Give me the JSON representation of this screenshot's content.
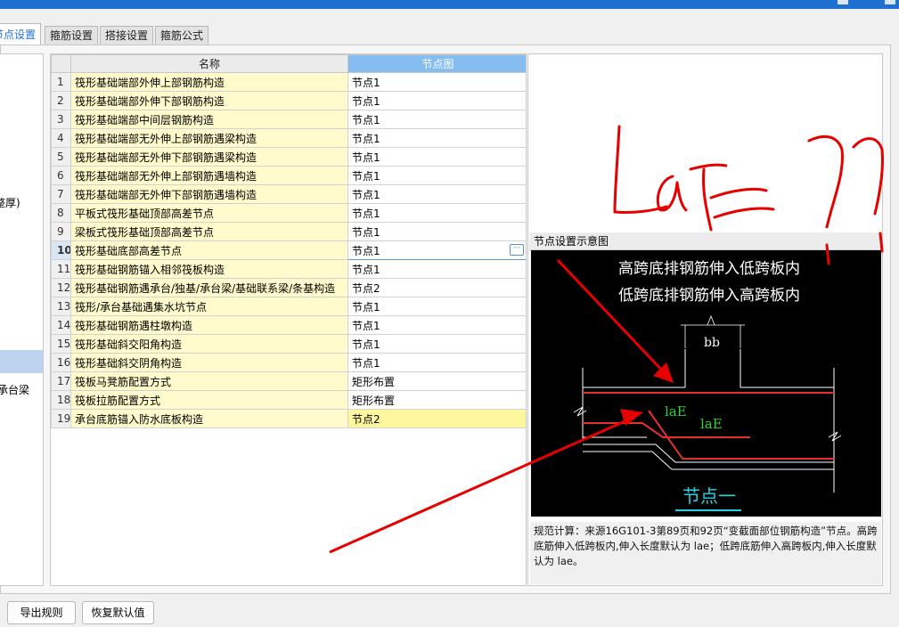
{
  "tabs": [
    {
      "label": "节点设置"
    },
    {
      "label": "箍筋设置"
    },
    {
      "label": "搭接设置"
    },
    {
      "label": "箍筋公式"
    }
  ],
  "left_list": {
    "items": [
      {
        "label": "整厚)"
      },
      {
        "label": ""
      },
      {
        "label": "承台梁"
      }
    ]
  },
  "grid": {
    "columns": [
      {
        "label": ""
      },
      {
        "label": "名称"
      },
      {
        "label": "节点图"
      }
    ],
    "rows": [
      {
        "num": "1",
        "name": "筏形基础端部外伸上部钢筋构造",
        "value": "节点1"
      },
      {
        "num": "2",
        "name": "筏形基础端部外伸下部钢筋构造",
        "value": "节点1"
      },
      {
        "num": "3",
        "name": "筏形基础端部中间层钢筋构造",
        "value": "节点1"
      },
      {
        "num": "4",
        "name": "筏形基础端部无外伸上部钢筋遇梁构造",
        "value": "节点1"
      },
      {
        "num": "5",
        "name": "筏形基础端部无外伸下部钢筋遇梁构造",
        "value": "节点1"
      },
      {
        "num": "6",
        "name": "筏形基础端部无外伸上部钢筋遇墙构造",
        "value": "节点1"
      },
      {
        "num": "7",
        "name": "筏形基础端部无外伸下部钢筋遇墙构造",
        "value": "节点1"
      },
      {
        "num": "8",
        "name": "平板式筏形基础顶部高差节点",
        "value": "节点1"
      },
      {
        "num": "9",
        "name": "梁板式筏形基础顶部高差节点",
        "value": "节点1"
      },
      {
        "num": "10",
        "name": "筏形基础底部高差节点",
        "value": "节点1"
      },
      {
        "num": "11",
        "name": "筏形基础钢筋锚入相邻筏板构造",
        "value": "节点1"
      },
      {
        "num": "12",
        "name": "筏形基础钢筋遇承台/独基/承台梁/基础联系梁/条基构造",
        "value": "节点2"
      },
      {
        "num": "13",
        "name": "筏形/承台基础遇集水坑节点",
        "value": "节点1"
      },
      {
        "num": "14",
        "name": "筏形基础钢筋遇柱墩构造",
        "value": "节点1"
      },
      {
        "num": "15",
        "name": "筏形基础斜交阳角构造",
        "value": "节点1"
      },
      {
        "num": "16",
        "name": "筏形基础斜交阴角构造",
        "value": "节点1"
      },
      {
        "num": "17",
        "name": "筏板马凳筋配置方式",
        "value": "矩形布置"
      },
      {
        "num": "18",
        "name": "筏板拉筋配置方式",
        "value": "矩形布置"
      },
      {
        "num": "19",
        "name": "承台底筋锚入防水底板构造",
        "value": "节点2"
      }
    ],
    "selected_row": "10",
    "more_button": "···"
  },
  "preview": {
    "title": "节点设置示意图",
    "line1": "高跨底排钢筋伸入低跨板内",
    "line2": "低跨底排钢筋伸入高跨板内",
    "label_bb": "bb",
    "label_lae1": "laE",
    "label_lae2": "laE",
    "caption": "节点一",
    "description": "规范计算：来源16G101-3第89页和92页“变截面部位钢筋构造”节点。高跨底筋伸入低跨板内,伸入长度默认为 lae；低跨底筋伸入高跨板内,伸入长度默认为 lae。"
  },
  "buttons": {
    "export": "导出规则",
    "restore": "恢复默认值"
  },
  "annotation": {
    "handwritten_text": "LaE=??",
    "color": "#e60000"
  },
  "colors": {
    "accent": "#1f6fd6",
    "header_highlight": "#86bdf0",
    "name_cell": "#fffbcc",
    "highlight_cell": "#fff79e"
  }
}
